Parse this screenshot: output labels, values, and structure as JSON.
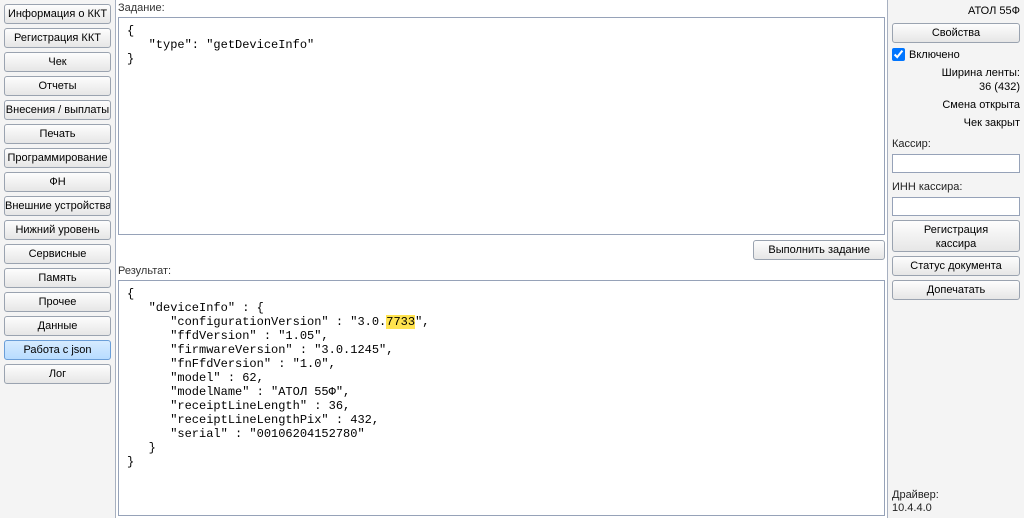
{
  "sidebar": {
    "items": [
      "Информация о ККТ",
      "Регистрация ККТ",
      "Чек",
      "Отчеты",
      "Внесения / выплаты",
      "Печать",
      "Программирование",
      "ФН",
      "Внешние устройства",
      "Нижний уровень",
      "Сервисные",
      "Память",
      "Прочее",
      "Данные",
      "Работа с json",
      "Лог"
    ],
    "activeIndex": 14
  },
  "center": {
    "task_label": "Задание:",
    "task_text": "{\n   \"type\": \"getDeviceInfo\"\n}",
    "execute_label": "Выполнить задание",
    "result_label": "Результат:",
    "result_before_hl": "{\n   \"deviceInfo\" : {\n      \"configurationVersion\" : \"3.0.",
    "result_hl": "7733",
    "result_after_hl": "\",\n      \"ffdVersion\" : \"1.05\",\n      \"firmwareVersion\" : \"3.0.1245\",\n      \"fnFfdVersion\" : \"1.0\",\n      \"model\" : 62,\n      \"modelName\" : \"АТОЛ 55Ф\",\n      \"receiptLineLength\" : 36,\n      \"receiptLineLengthPix\" : 432,\n      \"serial\" : \"00106204152780\"\n   }\n}"
  },
  "right": {
    "device_title": "АТОЛ 55Ф",
    "props_btn": "Свойства",
    "enabled_chk": "Включено",
    "tape_width_lbl": "Ширина ленты:",
    "tape_width_val": "36 (432)",
    "shift_state": "Смена открыта",
    "receipt_state": "Чек закрыт",
    "cashier_lbl": "Кассир:",
    "cashier_val": "",
    "cashier_inn_lbl": "ИНН кассира:",
    "cashier_inn_val": "",
    "reg_cashier_btn": "Регистрация\nкассира",
    "doc_status_btn": "Статус документа",
    "reprint_btn": "Допечатать",
    "driver_lbl": "Драйвер:",
    "driver_ver": "10.4.4.0"
  }
}
